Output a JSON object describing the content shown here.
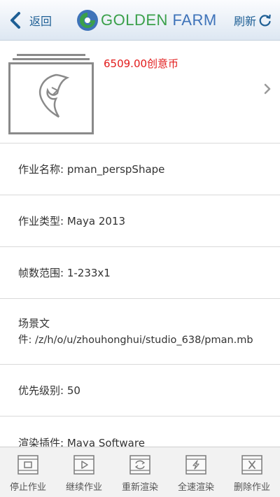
{
  "header": {
    "back_label": "返回",
    "logo_text_a": "GOLDEN",
    "logo_text_b": "FARM",
    "refresh_label": "刷新"
  },
  "summary": {
    "credit": "6509.00创意币"
  },
  "details": [
    {
      "label": "作业名称:",
      "value": "pman_perspShape"
    },
    {
      "label": "作业类型:",
      "value": "Maya 2013"
    },
    {
      "label": "帧数范围:",
      "value": "1-233x1"
    },
    {
      "label": "场景文",
      "label2": "件:",
      "value": "/z/h/o/u/zhouhonghui/studio_638/pman.mb"
    },
    {
      "label": "优先级别:",
      "value": "50"
    },
    {
      "label": "渲染插件:",
      "value": "Maya Software"
    }
  ],
  "toolbar": [
    {
      "label": "停止作业",
      "icon": "stop-icon"
    },
    {
      "label": "继续作业",
      "icon": "play-icon"
    },
    {
      "label": "重新渲染",
      "icon": "rerender-icon"
    },
    {
      "label": "全速渲染",
      "icon": "full-speed-icon"
    },
    {
      "label": "删除作业",
      "icon": "delete-icon"
    }
  ],
  "colors": {
    "accent_blue": "#1e5f95",
    "credit_red": "#e21b1b",
    "logo_green": "#3aa04a",
    "logo_blue": "#3e73b9"
  }
}
